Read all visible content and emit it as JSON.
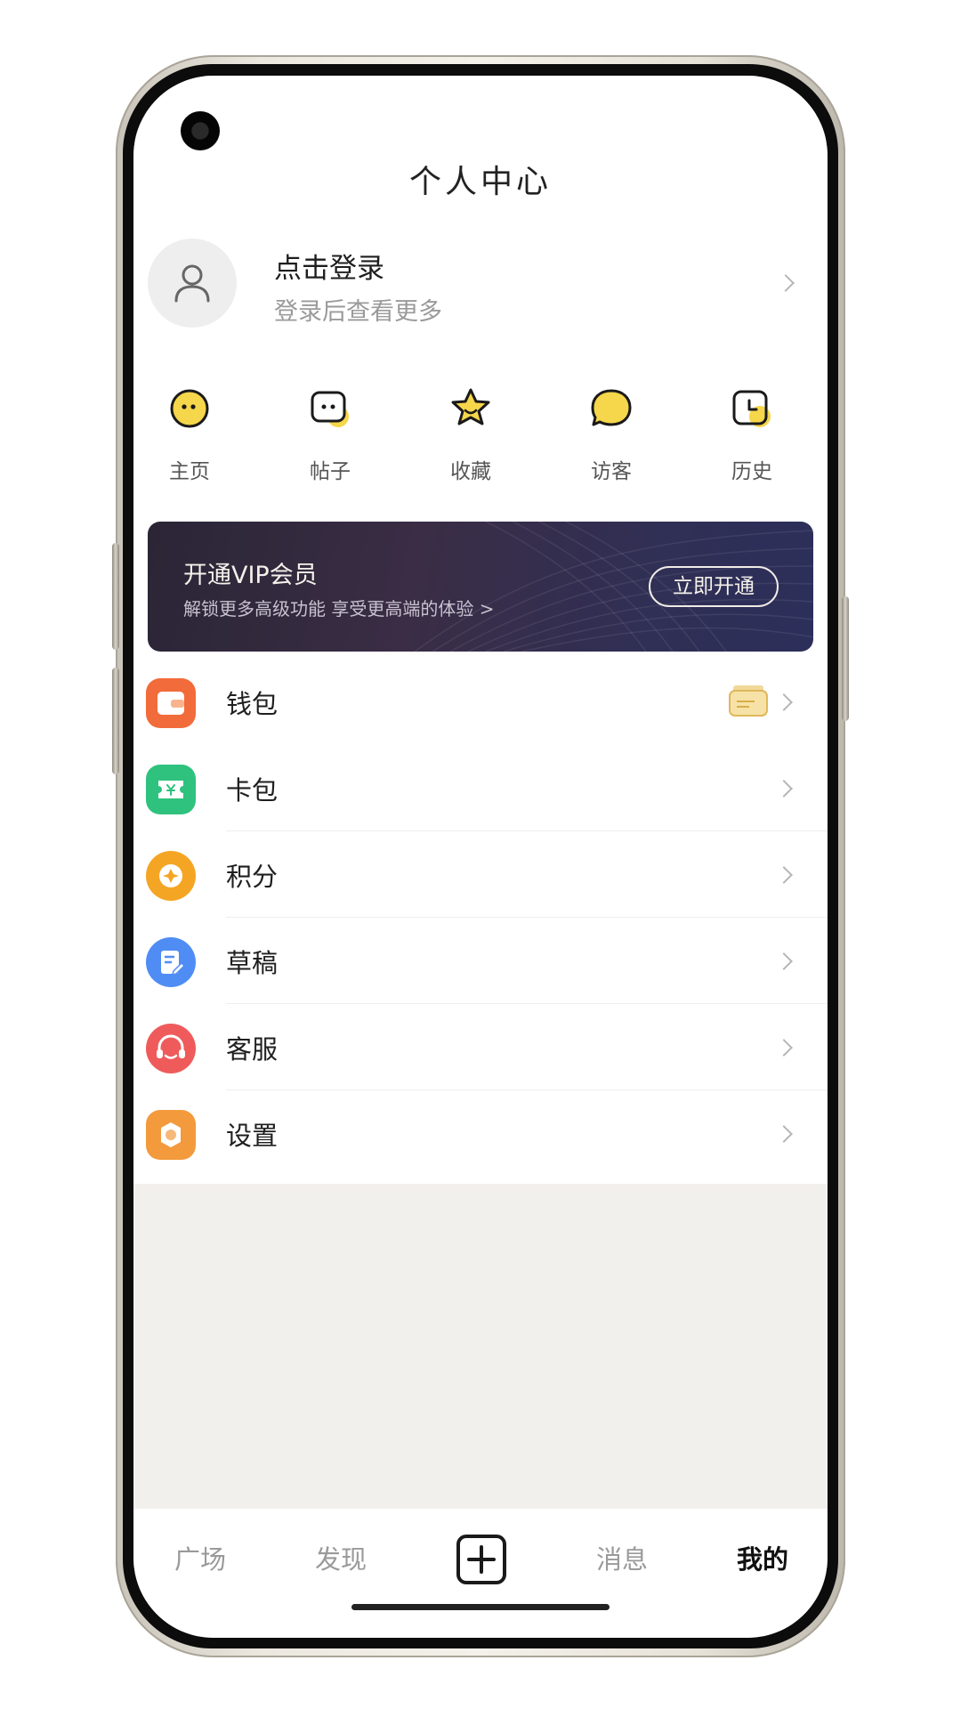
{
  "header": {
    "title": "个人中心"
  },
  "profile": {
    "title": "点击登录",
    "subtitle": "登录后查看更多",
    "avatar_icon": "user-icon"
  },
  "quick_actions": [
    {
      "label": "主页",
      "icon": "smiley-face-icon"
    },
    {
      "label": "帖子",
      "icon": "chat-box-icon"
    },
    {
      "label": "收藏",
      "icon": "star-icon"
    },
    {
      "label": "访客",
      "icon": "speech-bubble-icon"
    },
    {
      "label": "历史",
      "icon": "clock-icon"
    }
  ],
  "vip": {
    "title": "开通VIP会员",
    "subtitle": "解锁更多高级功能 享受更高端的体验 >",
    "button": "立即开通"
  },
  "menu": [
    {
      "label": "钱包",
      "icon": "wallet-icon",
      "color": "#f26b3a"
    },
    {
      "label": "卡包",
      "icon": "ticket-icon",
      "color": "#2ec27e"
    },
    {
      "label": "积分",
      "icon": "coin-icon",
      "color": "#f5a524"
    },
    {
      "label": "草稿",
      "icon": "draft-icon",
      "color": "#4f8df5"
    },
    {
      "label": "客服",
      "icon": "headset-icon",
      "color": "#ef5b5b"
    },
    {
      "label": "设置",
      "icon": "settings-icon",
      "color": "#f39a3c"
    }
  ],
  "tabs": [
    {
      "label": "广场"
    },
    {
      "label": "发现"
    },
    {
      "label": "消息"
    },
    {
      "label": "我的"
    }
  ],
  "colors": {
    "accent_yellow": "#f6d64a",
    "vip_bg": "#2c2a48"
  }
}
